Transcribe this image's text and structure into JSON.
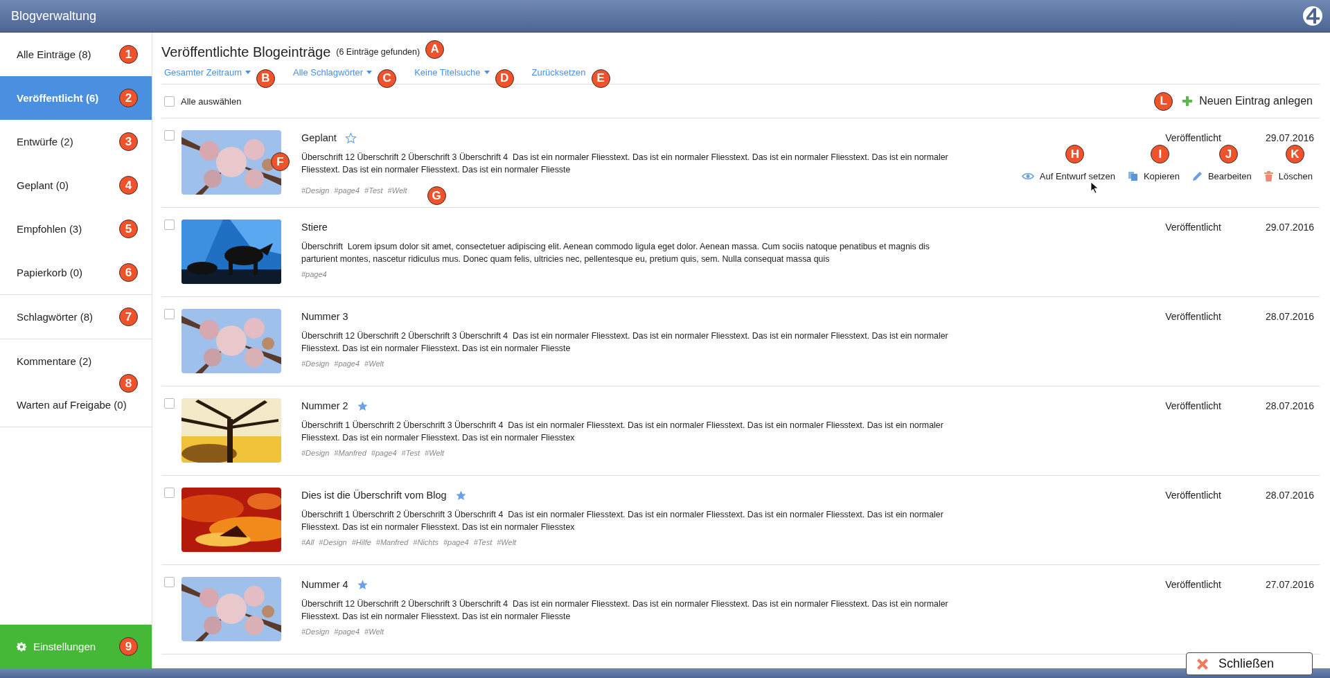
{
  "app_title": "Blogverwaltung",
  "sidebar": {
    "groups": [
      {
        "items": [
          {
            "label": "Alle Einträge (8)",
            "marker": "1",
            "selected": false
          },
          {
            "label": "Veröffentlicht (6)",
            "marker": "2",
            "selected": true
          },
          {
            "label": "Entwürfe (2)",
            "marker": "3",
            "selected": false
          },
          {
            "label": "Geplant (0)",
            "marker": "4",
            "selected": false
          },
          {
            "label": "Empfohlen (3)",
            "marker": "5",
            "selected": false
          },
          {
            "label": "Papierkorb (0)",
            "marker": "6",
            "selected": false
          }
        ]
      },
      {
        "items": [
          {
            "label": "Schlagwörter (8)",
            "marker": "7",
            "selected": false
          }
        ]
      },
      {
        "marker": "8",
        "items": [
          {
            "label": "Kommentare (2)",
            "selected": false
          },
          {
            "label": "Warten auf Freigabe (0)",
            "selected": false
          }
        ]
      }
    ],
    "settings": {
      "label": "Einstellungen",
      "marker": "9"
    }
  },
  "main": {
    "title": "Veröffentlichte Blogeinträge",
    "count": "(6 Einträge gefunden)",
    "marker": "A",
    "filters": [
      {
        "label": "Gesamter Zeitraum",
        "dropdown": true,
        "marker": "B"
      },
      {
        "label": "Alle Schlagwörter",
        "dropdown": true,
        "marker": "C"
      },
      {
        "label": "Keine Titelsuche",
        "dropdown": true,
        "marker": "D"
      },
      {
        "label": "Zurücksetzen",
        "dropdown": false,
        "marker": "E"
      }
    ],
    "select_all": {
      "label": "Alle auswählen",
      "checked": false
    },
    "new_entry": {
      "label": "Neuen Eintrag anlegen",
      "marker": "L"
    },
    "entries": [
      {
        "title": "Geplant",
        "star": {
          "filled": false
        },
        "checked": false,
        "image_marker": "F",
        "tags_marker": "G",
        "text": "Überschrift 12 Überschrift 2 Überschrift 3 Überschrift 4  Das ist ein normaler Fliesstext. Das ist ein normaler Fliesstext. Das ist ein normaler Fliesstext. Das ist ein normaler Fliesstext. Das ist ein normaler Fliesstext. Das ist ein normaler Fliesste",
        "tags": [
          "#Design",
          "#page4",
          "#Test",
          "#Welt"
        ],
        "status": "Veröffentlicht",
        "date": "29.07.2016",
        "actions": [
          {
            "kind": "draft",
            "label": "Auf Entwurf setzen",
            "marker": "H"
          },
          {
            "kind": "copy",
            "label": "Kopieren",
            "marker": "I"
          },
          {
            "kind": "edit",
            "label": "Bearbeiten",
            "marker": "J"
          },
          {
            "kind": "delete",
            "label": "Löschen",
            "marker": "K"
          }
        ]
      },
      {
        "title": "Stiere",
        "checked": false,
        "text": "Überschrift  Lorem ipsum dolor sit amet, consectetuer adipiscing elit. Aenean commodo ligula eget dolor. Aenean massa. Cum sociis natoque penatibus et magnis dis parturient montes, nascetur ridiculus mus. Donec quam felis, ultricies nec, pellentesque eu, pretium quis, sem. Nulla consequat massa quis",
        "tags": [
          "#page4"
        ],
        "status": "Veröffentlicht",
        "date": "29.07.2016"
      },
      {
        "title": "Nummer 3",
        "checked": false,
        "text": "Überschrift 12 Überschrift 2 Überschrift 3 Überschrift 4  Das ist ein normaler Fliesstext. Das ist ein normaler Fliesstext. Das ist ein normaler Fliesstext. Das ist ein normaler Fliesstext. Das ist ein normaler Fliesstext. Das ist ein normaler Fliesste",
        "tags": [
          "#Design",
          "#page4",
          "#Welt"
        ],
        "status": "Veröffentlicht",
        "date": "28.07.2016"
      },
      {
        "title": "Nummer 2",
        "star": {
          "filled": true
        },
        "checked": false,
        "text": "Überschrift 1 Überschrift 2 Überschrift 3 Überschrift 4  Das ist ein normaler Fliesstext. Das ist ein normaler Fliesstext. Das ist ein normaler Fliesstext. Das ist ein normaler Fliesstext. Das ist ein normaler Fliesstext. Das ist ein normaler Fliesstex",
        "tags": [
          "#Design",
          "#Manfred",
          "#page4",
          "#Test",
          "#Welt"
        ],
        "status": "Veröffentlicht",
        "date": "28.07.2016"
      },
      {
        "title": "Dies ist die Überschrift vom Blog",
        "star": {
          "filled": true
        },
        "checked": false,
        "text": "Überschrift 1 Überschrift 2 Überschrift 3 Überschrift 4  Das ist ein normaler Fliesstext. Das ist ein normaler Fliesstext. Das ist ein normaler Fliesstext. Das ist ein normaler Fliesstext. Das ist ein normaler Fliesstext. Das ist ein normaler Fliesstex",
        "tags": [
          "#All",
          "#Design",
          "#Hilfe",
          "#Manfred",
          "#Nichts",
          "#page4",
          "#Test",
          "#Welt"
        ],
        "status": "Veröffentlicht",
        "date": "28.07.2016"
      },
      {
        "title": "Nummer 4",
        "star": {
          "filled": true
        },
        "checked": false,
        "text": "Überschrift 12 Überschrift 2 Überschrift 3 Überschrift 4  Das ist ein normaler Fliesstext. Das ist ein normaler Fliesstext. Das ist ein normaler Fliesstext. Das ist ein normaler Fliesstext. Das ist ein normaler Fliesstext. Das ist ein normaler Fliesste",
        "tags": [
          "#Design",
          "#page4",
          "#Welt"
        ],
        "status": "Veröffentlicht",
        "date": "27.07.2016"
      }
    ]
  },
  "close_button": {
    "label": "Schließen"
  }
}
